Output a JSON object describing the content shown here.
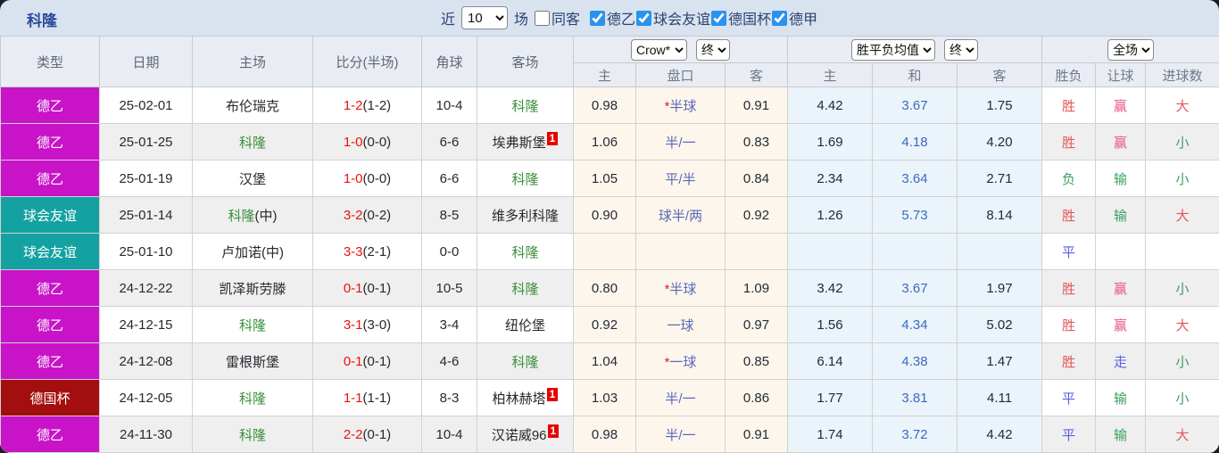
{
  "topbar": {
    "team_title": "科隆",
    "recent_prefix": "近",
    "recent_select_value": "10",
    "recent_suffix": "场",
    "same_away": {
      "label": "同客",
      "checked": false
    },
    "league_filters": [
      {
        "label": "德乙",
        "checked": true
      },
      {
        "label": "球会友谊",
        "checked": true
      },
      {
        "label": "德国杯",
        "checked": true
      },
      {
        "label": "德甲",
        "checked": true
      }
    ]
  },
  "table": {
    "static_headers": [
      "类型",
      "日期",
      "主场",
      "比分(半场)",
      "角球",
      "客场"
    ],
    "groups": [
      {
        "selects": [
          "Crow*",
          "终"
        ],
        "sub_headers": [
          "主",
          "盘口",
          "客"
        ]
      },
      {
        "selects": [
          "胜平负均值",
          "终"
        ],
        "sub_headers": [
          "主",
          "和",
          "客"
        ]
      },
      {
        "selects": [
          "全场"
        ],
        "sub_headers": [
          "胜负",
          "让球",
          "进球数"
        ]
      }
    ],
    "league_colors": {
      "德乙": "#c813c8",
      "球会友谊": "#14a1a1",
      "德国杯": "#a30f0f"
    },
    "status_colors": {
      "win": "#e25757",
      "win_pink": "#ea548c",
      "lose": "#3c9f60",
      "draw": "#5d5de8",
      "kolin_green": "#3a8f3a",
      "score_red": "#f01010",
      "badge_red": "#e60000"
    },
    "rows": [
      {
        "league": "德乙",
        "date": "25-02-01",
        "home": "布伦瑞克",
        "home_is_kolin": false,
        "home_suffix": "",
        "score_full": "1-2",
        "score_half": "(1-2)",
        "corners": "10-4",
        "away": "科隆",
        "away_is_kolin": true,
        "away_badge": "",
        "asia_home": "0.98",
        "asia_line_star": true,
        "asia_line": "半球",
        "asia_away": "0.91",
        "euro_home": "4.42",
        "euro_draw": "3.67",
        "euro_away": "1.75",
        "result": "胜",
        "result_tone": "win",
        "spread": "赢",
        "spread_tone": "win_pink",
        "goals": "大",
        "goals_tone": "win"
      },
      {
        "league": "德乙",
        "date": "25-01-25",
        "home": "科隆",
        "home_is_kolin": true,
        "home_suffix": "",
        "score_full": "1-0",
        "score_half": "(0-0)",
        "corners": "6-6",
        "away": "埃弗斯堡",
        "away_is_kolin": false,
        "away_badge": "1",
        "asia_home": "1.06",
        "asia_line_star": false,
        "asia_line": "半/一",
        "asia_away": "0.83",
        "euro_home": "1.69",
        "euro_draw": "4.18",
        "euro_away": "4.20",
        "result": "胜",
        "result_tone": "win",
        "spread": "赢",
        "spread_tone": "win_pink",
        "goals": "小",
        "goals_tone": "lose"
      },
      {
        "league": "德乙",
        "date": "25-01-19",
        "home": "汉堡",
        "home_is_kolin": false,
        "home_suffix": "",
        "score_full": "1-0",
        "score_half": "(0-0)",
        "corners": "6-6",
        "away": "科隆",
        "away_is_kolin": true,
        "away_badge": "",
        "asia_home": "1.05",
        "asia_line_star": false,
        "asia_line": "平/半",
        "asia_away": "0.84",
        "euro_home": "2.34",
        "euro_draw": "3.64",
        "euro_away": "2.71",
        "result": "负",
        "result_tone": "lose",
        "spread": "输",
        "spread_tone": "lose",
        "goals": "小",
        "goals_tone": "lose"
      },
      {
        "league": "球会友谊",
        "date": "25-01-14",
        "home": "科隆",
        "home_is_kolin": true,
        "home_suffix": "(中)",
        "score_full": "3-2",
        "score_half": "(0-2)",
        "corners": "8-5",
        "away": "维多利科隆",
        "away_is_kolin": false,
        "away_badge": "",
        "asia_home": "0.90",
        "asia_line_star": false,
        "asia_line": "球半/两",
        "asia_away": "0.92",
        "euro_home": "1.26",
        "euro_draw": "5.73",
        "euro_away": "8.14",
        "result": "胜",
        "result_tone": "win",
        "spread": "输",
        "spread_tone": "lose",
        "goals": "大",
        "goals_tone": "win"
      },
      {
        "league": "球会友谊",
        "date": "25-01-10",
        "home": "卢加诺(中)",
        "home_is_kolin": false,
        "home_suffix": "",
        "score_full": "3-3",
        "score_half": "(2-1)",
        "corners": "0-0",
        "away": "科隆",
        "away_is_kolin": true,
        "away_badge": "",
        "asia_home": "",
        "asia_line_star": false,
        "asia_line": "",
        "asia_away": "",
        "euro_home": "",
        "euro_draw": "",
        "euro_away": "",
        "result": "平",
        "result_tone": "draw",
        "spread": "",
        "spread_tone": "draw",
        "goals": "",
        "goals_tone": "draw"
      },
      {
        "league": "德乙",
        "date": "24-12-22",
        "home": "凯泽斯劳滕",
        "home_is_kolin": false,
        "home_suffix": "",
        "score_full": "0-1",
        "score_half": "(0-1)",
        "corners": "10-5",
        "away": "科隆",
        "away_is_kolin": true,
        "away_badge": "",
        "asia_home": "0.80",
        "asia_line_star": true,
        "asia_line": "半球",
        "asia_away": "1.09",
        "euro_home": "3.42",
        "euro_draw": "3.67",
        "euro_away": "1.97",
        "result": "胜",
        "result_tone": "win",
        "spread": "赢",
        "spread_tone": "win_pink",
        "goals": "小",
        "goals_tone": "lose"
      },
      {
        "league": "德乙",
        "date": "24-12-15",
        "home": "科隆",
        "home_is_kolin": true,
        "home_suffix": "",
        "score_full": "3-1",
        "score_half": "(3-0)",
        "corners": "3-4",
        "away": "纽伦堡",
        "away_is_kolin": false,
        "away_badge": "",
        "asia_home": "0.92",
        "asia_line_star": false,
        "asia_line": "一球",
        "asia_away": "0.97",
        "euro_home": "1.56",
        "euro_draw": "4.34",
        "euro_away": "5.02",
        "result": "胜",
        "result_tone": "win",
        "spread": "赢",
        "spread_tone": "win_pink",
        "goals": "大",
        "goals_tone": "win"
      },
      {
        "league": "德乙",
        "date": "24-12-08",
        "home": "雷根斯堡",
        "home_is_kolin": false,
        "home_suffix": "",
        "score_full": "0-1",
        "score_half": "(0-1)",
        "corners": "4-6",
        "away": "科隆",
        "away_is_kolin": true,
        "away_badge": "",
        "asia_home": "1.04",
        "asia_line_star": true,
        "asia_line": "一球",
        "asia_away": "0.85",
        "euro_home": "6.14",
        "euro_draw": "4.38",
        "euro_away": "1.47",
        "result": "胜",
        "result_tone": "win",
        "spread": "走",
        "spread_tone": "draw",
        "goals": "小",
        "goals_tone": "lose"
      },
      {
        "league": "德国杯",
        "date": "24-12-05",
        "home": "科隆",
        "home_is_kolin": true,
        "home_suffix": "",
        "score_full": "1-1",
        "score_half": "(1-1)",
        "corners": "8-3",
        "away": "柏林赫塔",
        "away_is_kolin": false,
        "away_badge": "1",
        "asia_home": "1.03",
        "asia_line_star": false,
        "asia_line": "半/一",
        "asia_away": "0.86",
        "euro_home": "1.77",
        "euro_draw": "3.81",
        "euro_away": "4.11",
        "result": "平",
        "result_tone": "draw",
        "spread": "输",
        "spread_tone": "lose",
        "goals": "小",
        "goals_tone": "lose"
      },
      {
        "league": "德乙",
        "date": "24-11-30",
        "home": "科隆",
        "home_is_kolin": true,
        "home_suffix": "",
        "score_full": "2-2",
        "score_half": "(0-1)",
        "corners": "10-4",
        "away": "汉诺威96",
        "away_is_kolin": false,
        "away_badge": "1",
        "asia_home": "0.98",
        "asia_line_star": false,
        "asia_line": "半/一",
        "asia_away": "0.91",
        "euro_home": "1.74",
        "euro_draw": "3.72",
        "euro_away": "4.42",
        "result": "平",
        "result_tone": "draw",
        "spread": "输",
        "spread_tone": "lose",
        "goals": "大",
        "goals_tone": "win"
      }
    ]
  }
}
